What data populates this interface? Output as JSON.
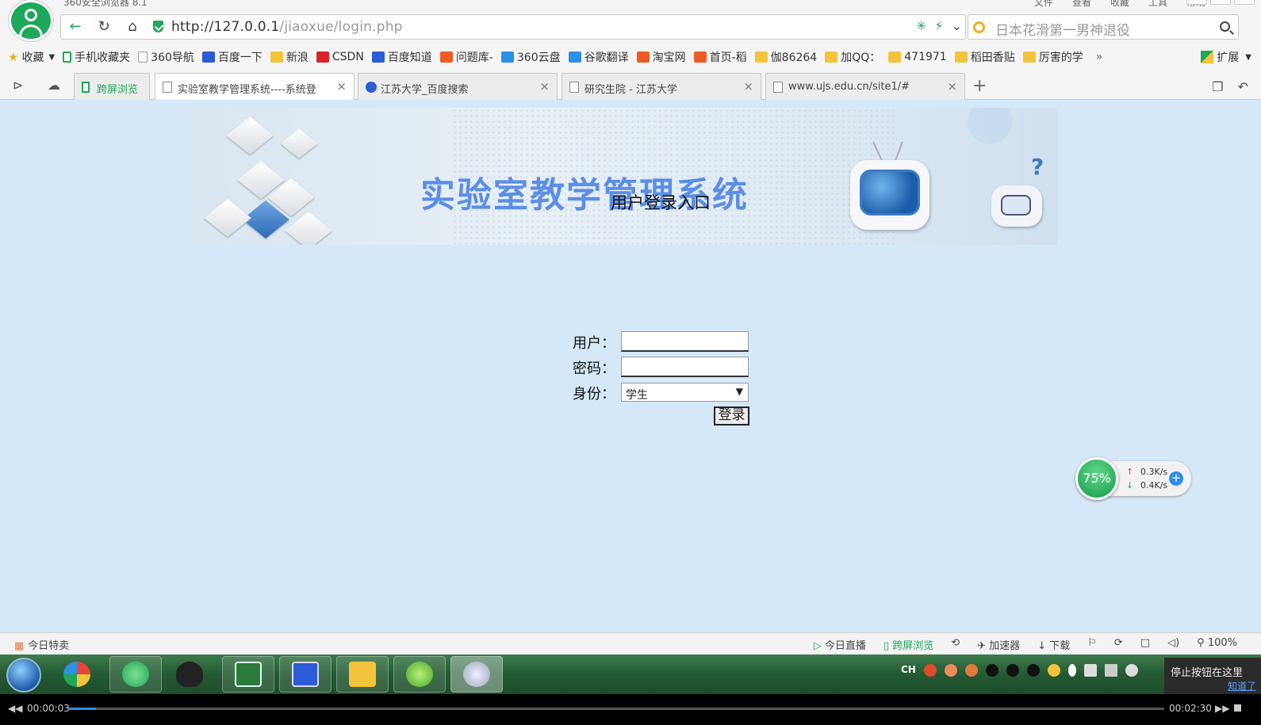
{
  "browser": {
    "app_title": "360安全浏览器 8.1",
    "title_menu": [
      "文件",
      "查看",
      "收藏",
      "工具",
      "帮助"
    ],
    "url_host": "http://127.0.0.1",
    "url_path": "/jiaoxue/login.php",
    "search_placeholder": "日本花滑第一男神退役",
    "bookmarks": [
      "收藏",
      "手机收藏夹",
      "360导航",
      "百度一下",
      "新浪",
      "CSDN",
      "百度知道",
      "问题库-",
      "360云盘",
      "谷歌翻译",
      "淘宝网",
      "首页-稻",
      "伽86264",
      "加QQ：",
      "471971",
      "稻田香贴",
      "厉害的学"
    ],
    "extensions_label": "扩展",
    "tabs": [
      {
        "label": "跨屏浏览"
      },
      {
        "label": "实验室教学管理系统----系统登"
      },
      {
        "label": "江苏大学_百度搜索"
      },
      {
        "label": "研究生院 - 江苏大学"
      },
      {
        "label": "www.ujs.edu.cn/site1/#"
      }
    ]
  },
  "page": {
    "banner_title": "实验室教学管理系统",
    "login_title": "用户登录入口",
    "user_label": "用户：",
    "password_label": "密码：",
    "role_label": "身份：",
    "role_value": "学生",
    "login_button": "登录"
  },
  "net_widget": {
    "percent": "75%",
    "upload": "0.3K/s",
    "download": "0.4K/s"
  },
  "statusbar": {
    "sale": "今日特卖",
    "items": [
      "今日直播",
      "跨屏浏览",
      "加速器",
      "下载"
    ],
    "zoom": "100%"
  },
  "taskbar": {
    "tray_lang": "CH",
    "tip_text": "停止按钮在这里",
    "tip_link": "知道了"
  },
  "player": {
    "current_time": "00:00:03",
    "total_time": "00:02:30",
    "progress": 0.025
  }
}
